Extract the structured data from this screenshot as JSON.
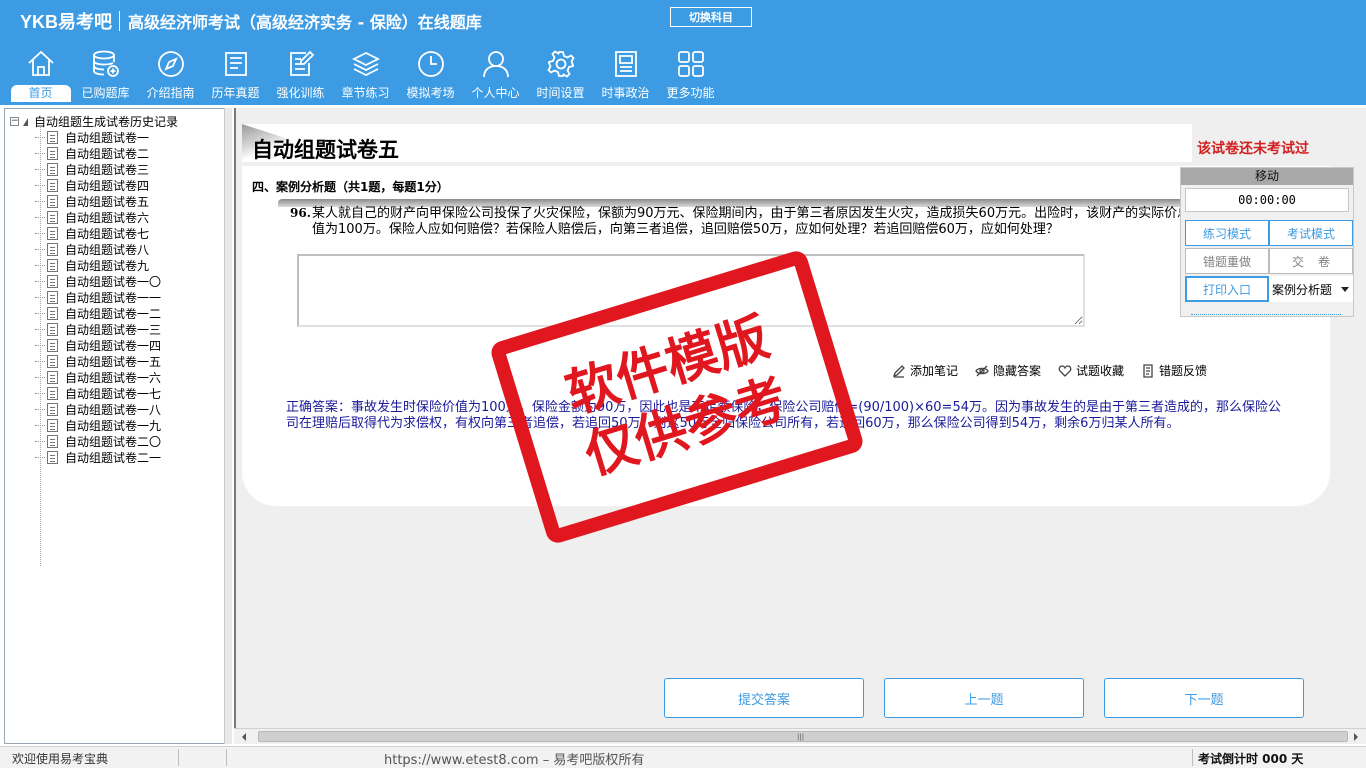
{
  "header": {
    "logo": "YKB易考吧",
    "title": "高级经济师考试（高级经济实务 - 保险）在线题库",
    "switch_subject": "切换科目"
  },
  "nav": [
    {
      "label": "首页",
      "icon": "home-icon"
    },
    {
      "label": "已购题库",
      "icon": "database-add-icon"
    },
    {
      "label": "介绍指南",
      "icon": "compass-icon"
    },
    {
      "label": "历年真题",
      "icon": "document-list-icon"
    },
    {
      "label": "强化训练",
      "icon": "edit-document-icon"
    },
    {
      "label": "章节练习",
      "icon": "layers-icon"
    },
    {
      "label": "模拟考场",
      "icon": "clock-icon"
    },
    {
      "label": "个人中心",
      "icon": "user-icon"
    },
    {
      "label": "时间设置",
      "icon": "gear-icon"
    },
    {
      "label": "时事政治",
      "icon": "newspaper-icon"
    },
    {
      "label": "更多功能",
      "icon": "grid-icon"
    }
  ],
  "tree": {
    "root": "自动组题生成试卷历史记录",
    "root_toggle": "−",
    "items": [
      "自动组题试卷一",
      "自动组题试卷二",
      "自动组题试卷三",
      "自动组题试卷四",
      "自动组题试卷五",
      "自动组题试卷六",
      "自动组题试卷七",
      "自动组题试卷八",
      "自动组题试卷九",
      "自动组题试卷一〇",
      "自动组题试卷一一",
      "自动组题试卷一二",
      "自动组题试卷一三",
      "自动组题试卷一四",
      "自动组题试卷一五",
      "自动组题试卷一六",
      "自动组题试卷一七",
      "自动组题试卷一八",
      "自动组题试卷一九",
      "自动组题试卷二〇",
      "自动组题试卷二一"
    ]
  },
  "paper": {
    "title": "自动组题试卷五",
    "status": "该试卷还未考试过",
    "section": "四、案例分析题（共1题，每题1分）",
    "question_number": "96.",
    "question_text": "某人就自己的财产向甲保险公司投保了火灾保险，保额为90万元、保险期间内，由于第三者原因发生火灾，造成损失60万元。出险时，该财产的实际价总值为100万。保险人应如何赔偿？若保险人赔偿后，向第三者追偿，追回赔偿50万，应如何处理？若追回赔偿60万，应如何处理？",
    "answer_value": "",
    "actions": [
      {
        "label": "添加笔记",
        "icon": "pencil-icon"
      },
      {
        "label": "隐藏答案",
        "icon": "eye-hide-icon"
      },
      {
        "label": "试题收藏",
        "icon": "heart-icon"
      },
      {
        "label": "错题反馈",
        "icon": "feedback-icon"
      }
    ],
    "correct_answer": "正确答案：事故发生时保险价值为100万，保险金额为90万，因此也是不足额保险，保险公司赔偿=(90/100)×60=54万。因为事故发生的是由于第三者造成的，那么保险公司在理赔后取得代为求偿权，有权向第三者追偿，若追回50万，则这50万全归保险公司所有，若追回60万，那么保险公司得到54万，剩余6万归某人所有。"
  },
  "float_panel": {
    "move": "移动",
    "timer": "00:00:00",
    "practice_mode": "练习模式",
    "exam_mode": "考试模式",
    "redo_wrong": "错题重做",
    "submit_paper": "交卷",
    "print_entry": "打印入口",
    "question_type": "案例分析题"
  },
  "bottom": {
    "submit_answer": "提交答案",
    "prev": "上一题",
    "next": "下一题"
  },
  "watermark": {
    "line1": "软件模版",
    "line2": "仅供参考"
  },
  "statusbar": {
    "welcome": "欢迎使用易考宝典",
    "copyright": "https://www.etest8.com – 易考吧版权所有",
    "countdown": "考试倒计时 000 天"
  },
  "colors": {
    "header_bg": "#3d9be3",
    "status_red": "#d02020",
    "answer_blue": "#1a1a9a",
    "stamp_red": "#e0171e"
  }
}
